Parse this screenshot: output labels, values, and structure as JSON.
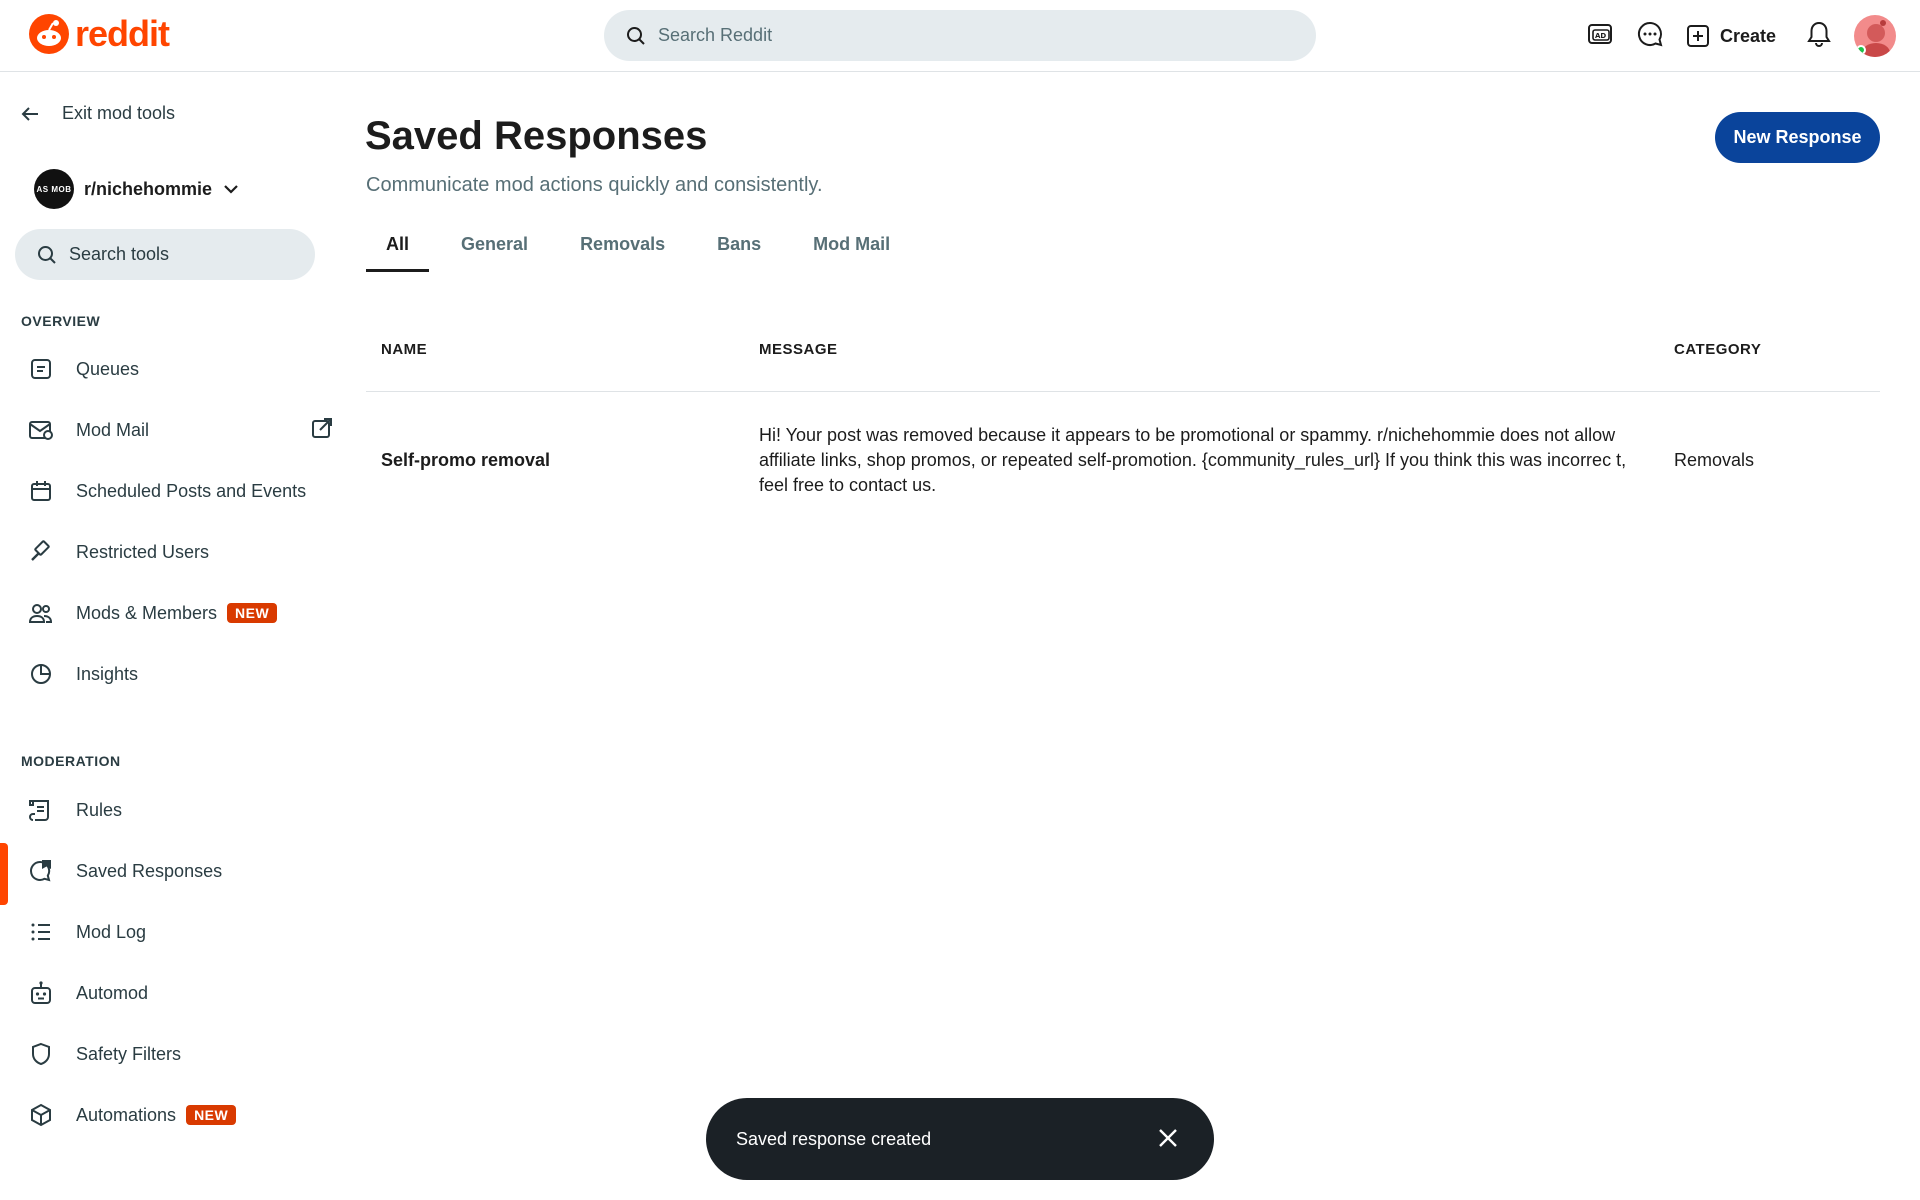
{
  "header": {
    "logo_text": "reddit",
    "search_placeholder": "Search Reddit",
    "create_label": "Create"
  },
  "sidebar": {
    "exit_label": "Exit mod tools",
    "community_name": "r/nichehommie",
    "community_avatar_text": "AS MOB",
    "search_placeholder": "Search tools",
    "overview_label": "OVERVIEW",
    "moderation_label": "MODERATION",
    "overview_items": [
      {
        "label": "Queues",
        "icon": "queue-icon"
      },
      {
        "label": "Mod Mail",
        "icon": "mail-icon"
      },
      {
        "label": "Scheduled Posts and Events",
        "icon": "calendar-icon"
      },
      {
        "label": "Restricted Users",
        "icon": "gavel-icon"
      },
      {
        "label": "Mods & Members",
        "icon": "users-icon",
        "badge": "NEW"
      },
      {
        "label": "Insights",
        "icon": "pie-chart-icon"
      }
    ],
    "moderation_items": [
      {
        "label": "Rules",
        "icon": "rules-icon"
      },
      {
        "label": "Saved Responses",
        "icon": "saved-response-icon",
        "active": true
      },
      {
        "label": "Mod Log",
        "icon": "list-icon"
      },
      {
        "label": "Automod",
        "icon": "robot-icon"
      },
      {
        "label": "Safety Filters",
        "icon": "shield-icon"
      },
      {
        "label": "Automations",
        "icon": "box-icon",
        "badge": "NEW"
      }
    ]
  },
  "main": {
    "title": "Saved Responses",
    "subtitle": "Communicate mod actions quickly and consistently.",
    "new_button": "New Response",
    "tabs": [
      "All",
      "General",
      "Removals",
      "Bans",
      "Mod Mail"
    ],
    "active_tab": "All",
    "table": {
      "headers": [
        "NAME",
        "MESSAGE",
        "CATEGORY"
      ],
      "rows": [
        {
          "name": "Self-promo removal",
          "message": "Hi! Your post was removed because it appears to be promotional or spammy. r/nichehommie does not allow affiliate links, shop promos, or repeated self-promotion. {community_rules_url} If you think this was incorrec t, feel free to contact us.",
          "category": "Removals"
        }
      ]
    }
  },
  "toast": {
    "message": "Saved response created"
  },
  "colors": {
    "brand": "#ff4500",
    "primary_button": "#0a449b",
    "badge": "#d93a00",
    "toast_bg": "#1b2126"
  }
}
